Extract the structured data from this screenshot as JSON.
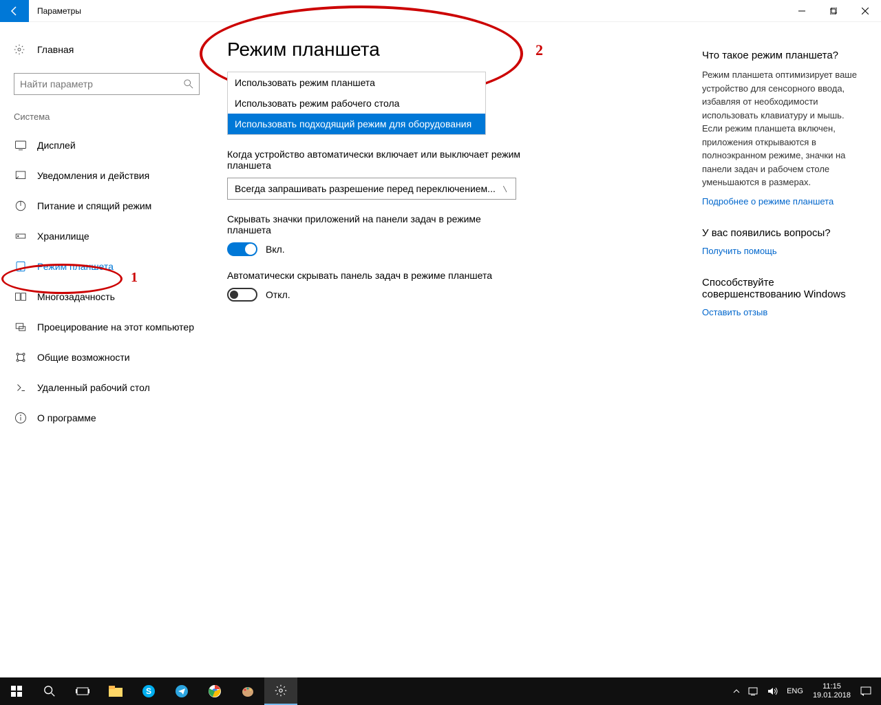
{
  "window": {
    "title": "Параметры"
  },
  "sidebar": {
    "home": "Главная",
    "search_placeholder": "Найти параметр",
    "section": "Система",
    "items": [
      {
        "label": "Дисплей"
      },
      {
        "label": "Уведомления и действия"
      },
      {
        "label": "Питание и спящий режим"
      },
      {
        "label": "Хранилище"
      },
      {
        "label": "Режим планшета"
      },
      {
        "label": "Многозадачность"
      },
      {
        "label": "Проецирование на этот компьютер"
      },
      {
        "label": "Общие возможности"
      },
      {
        "label": "Удаленный рабочий стол"
      },
      {
        "label": "О программе"
      }
    ]
  },
  "main": {
    "title": "Режим планшета",
    "dropdown1_items": [
      "Использовать режим планшета",
      "Использовать режим рабочего стола",
      "Использовать подходящий режим для оборудования"
    ],
    "setting2_label": "Когда устройство автоматически включает или выключает режим планшета",
    "dropdown2_value": "Всегда запрашивать разрешение перед переключением...",
    "setting3_label": "Скрывать значки приложений на панели задач в режиме планшета",
    "toggle_on": "Вкл.",
    "setting4_label": "Автоматически скрывать панель задач в режиме планшета",
    "toggle_off": "Откл."
  },
  "rightpane": {
    "h1": "Что такое режим планшета?",
    "p1": "Режим планшета оптимизирует ваше устройство для сенсорного ввода, избавляя от необходимости использовать клавиатуру и мышь. Если режим планшета включен, приложения открываются в полноэкранном режиме, значки на панели задач и рабочем столе уменьшаются в размерах.",
    "link1": "Подробнее о режиме планшета",
    "h2": "У вас появились вопросы?",
    "link2": "Получить помощь",
    "h3": "Способствуйте совершенствованию Windows",
    "link3": "Оставить отзыв"
  },
  "taskbar": {
    "lang": "ENG",
    "time": "11:15",
    "date": "19.01.2018"
  },
  "annotations": {
    "one": "1",
    "two": "2"
  }
}
